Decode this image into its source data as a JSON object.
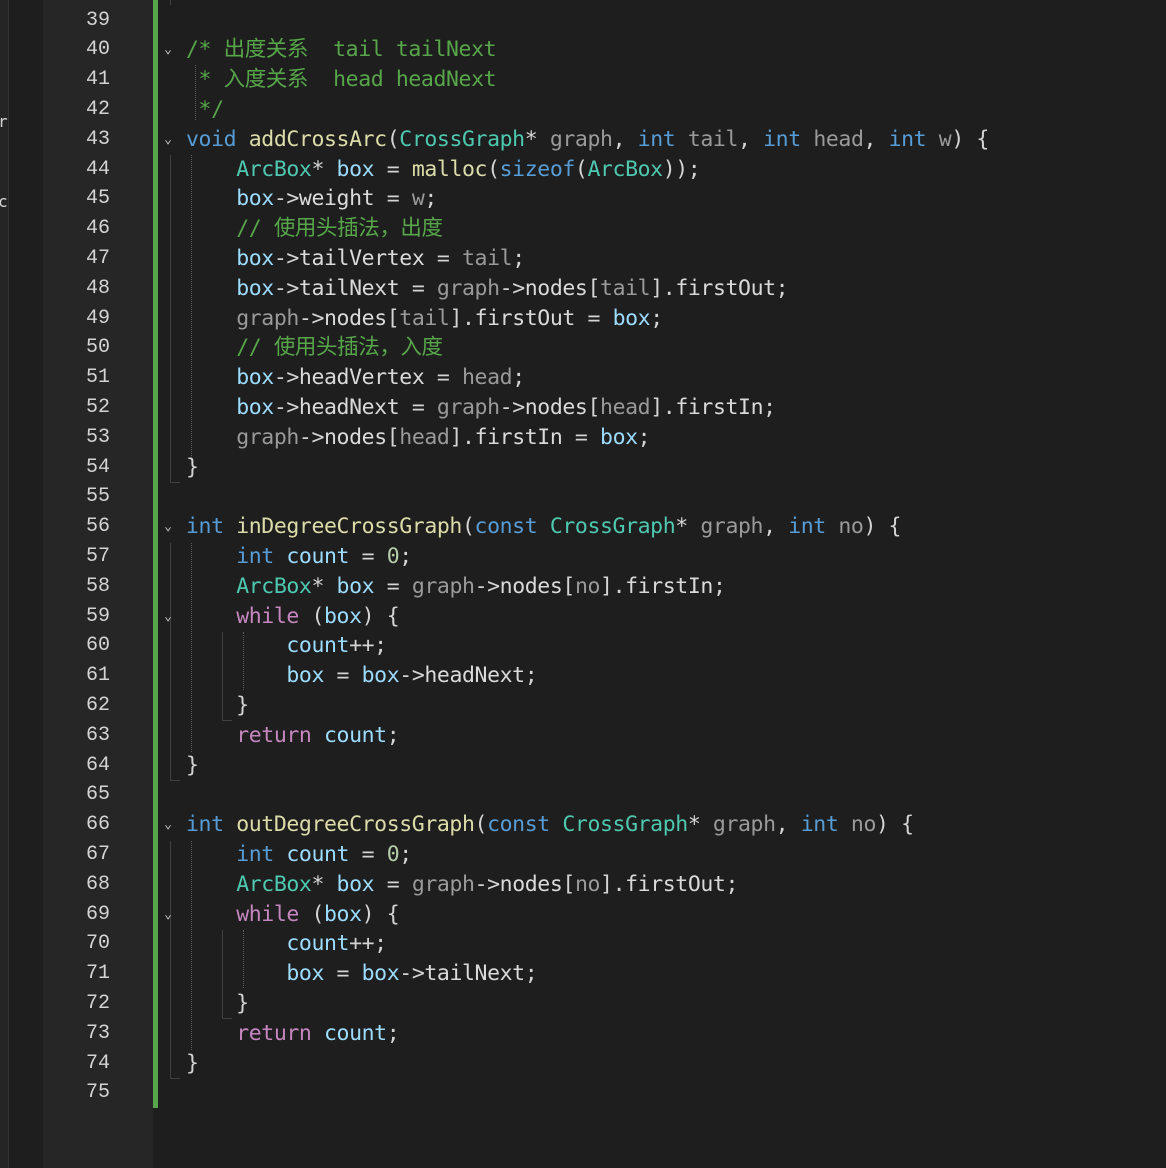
{
  "editor": {
    "language": "C",
    "accent_change_bar": "#58a64b",
    "edge_glyphs": [
      "r",
      "c"
    ],
    "lines": [
      {
        "n": "39",
        "fold": false,
        "tokens": []
      },
      {
        "n": "40",
        "fold": true,
        "tokens": [
          [
            "cm",
            "/* 出度关系  tail tailNext"
          ]
        ]
      },
      {
        "n": "41",
        "fold": false,
        "tokens": [
          [
            "cm",
            " * 入度关系  head headNext"
          ]
        ]
      },
      {
        "n": "42",
        "fold": false,
        "tokens": [
          [
            "cm",
            " */"
          ]
        ]
      },
      {
        "n": "43",
        "fold": true,
        "tokens": [
          [
            "kw",
            "void"
          ],
          [
            "op",
            " "
          ],
          [
            "fn",
            "addCrossArc"
          ],
          [
            "op",
            "("
          ],
          [
            "ty",
            "CrossGraph"
          ],
          [
            "op",
            "* "
          ],
          [
            "prm",
            "graph"
          ],
          [
            "op",
            ", "
          ],
          [
            "kw",
            "int"
          ],
          [
            "op",
            " "
          ],
          [
            "prm",
            "tail"
          ],
          [
            "op",
            ", "
          ],
          [
            "kw",
            "int"
          ],
          [
            "op",
            " "
          ],
          [
            "prm",
            "head"
          ],
          [
            "op",
            ", "
          ],
          [
            "kw",
            "int"
          ],
          [
            "op",
            " "
          ],
          [
            "prm",
            "w"
          ],
          [
            "op",
            ") {"
          ]
        ]
      },
      {
        "n": "44",
        "fold": false,
        "tokens": [
          [
            "op",
            "    "
          ],
          [
            "ty",
            "ArcBox"
          ],
          [
            "op",
            "* "
          ],
          [
            "var",
            "box"
          ],
          [
            "op",
            " = "
          ],
          [
            "fn",
            "malloc"
          ],
          [
            "op",
            "("
          ],
          [
            "kw",
            "sizeof"
          ],
          [
            "op",
            "("
          ],
          [
            "ty",
            "ArcBox"
          ],
          [
            "op",
            "));"
          ]
        ]
      },
      {
        "n": "45",
        "fold": false,
        "tokens": [
          [
            "op",
            "    "
          ],
          [
            "var",
            "box"
          ],
          [
            "op",
            "->"
          ],
          [
            "mem",
            "weight"
          ],
          [
            "op",
            " = "
          ],
          [
            "prm",
            "w"
          ],
          [
            "op",
            ";"
          ]
        ]
      },
      {
        "n": "46",
        "fold": false,
        "tokens": [
          [
            "op",
            "    "
          ],
          [
            "cm",
            "// 使用头插法，出度"
          ]
        ]
      },
      {
        "n": "47",
        "fold": false,
        "tokens": [
          [
            "op",
            "    "
          ],
          [
            "var",
            "box"
          ],
          [
            "op",
            "->"
          ],
          [
            "mem",
            "tailVertex"
          ],
          [
            "op",
            " = "
          ],
          [
            "prm",
            "tail"
          ],
          [
            "op",
            ";"
          ]
        ]
      },
      {
        "n": "48",
        "fold": false,
        "tokens": [
          [
            "op",
            "    "
          ],
          [
            "var",
            "box"
          ],
          [
            "op",
            "->"
          ],
          [
            "mem",
            "tailNext"
          ],
          [
            "op",
            " = "
          ],
          [
            "prm",
            "graph"
          ],
          [
            "op",
            "->"
          ],
          [
            "mem",
            "nodes"
          ],
          [
            "op",
            "["
          ],
          [
            "prm",
            "tail"
          ],
          [
            "op",
            "]."
          ],
          [
            "mem",
            "firstOut"
          ],
          [
            "op",
            ";"
          ]
        ]
      },
      {
        "n": "49",
        "fold": false,
        "tokens": [
          [
            "op",
            "    "
          ],
          [
            "prm",
            "graph"
          ],
          [
            "op",
            "->"
          ],
          [
            "mem",
            "nodes"
          ],
          [
            "op",
            "["
          ],
          [
            "prm",
            "tail"
          ],
          [
            "op",
            "]."
          ],
          [
            "mem",
            "firstOut"
          ],
          [
            "op",
            " = "
          ],
          [
            "var",
            "box"
          ],
          [
            "op",
            ";"
          ]
        ]
      },
      {
        "n": "50",
        "fold": false,
        "tokens": [
          [
            "op",
            "    "
          ],
          [
            "cm",
            "// 使用头插法，入度"
          ]
        ]
      },
      {
        "n": "51",
        "fold": false,
        "tokens": [
          [
            "op",
            "    "
          ],
          [
            "var",
            "box"
          ],
          [
            "op",
            "->"
          ],
          [
            "mem",
            "headVertex"
          ],
          [
            "op",
            " = "
          ],
          [
            "prm",
            "head"
          ],
          [
            "op",
            ";"
          ]
        ]
      },
      {
        "n": "52",
        "fold": false,
        "tokens": [
          [
            "op",
            "    "
          ],
          [
            "var",
            "box"
          ],
          [
            "op",
            "->"
          ],
          [
            "mem",
            "headNext"
          ],
          [
            "op",
            " = "
          ],
          [
            "prm",
            "graph"
          ],
          [
            "op",
            "->"
          ],
          [
            "mem",
            "nodes"
          ],
          [
            "op",
            "["
          ],
          [
            "prm",
            "head"
          ],
          [
            "op",
            "]."
          ],
          [
            "mem",
            "firstIn"
          ],
          [
            "op",
            ";"
          ]
        ]
      },
      {
        "n": "53",
        "fold": false,
        "tokens": [
          [
            "op",
            "    "
          ],
          [
            "prm",
            "graph"
          ],
          [
            "op",
            "->"
          ],
          [
            "mem",
            "nodes"
          ],
          [
            "op",
            "["
          ],
          [
            "prm",
            "head"
          ],
          [
            "op",
            "]."
          ],
          [
            "mem",
            "firstIn"
          ],
          [
            "op",
            " = "
          ],
          [
            "var",
            "box"
          ],
          [
            "op",
            ";"
          ]
        ]
      },
      {
        "n": "54",
        "fold": false,
        "tokens": [
          [
            "op",
            "}"
          ]
        ]
      },
      {
        "n": "55",
        "fold": false,
        "tokens": []
      },
      {
        "n": "56",
        "fold": true,
        "tokens": [
          [
            "kw",
            "int"
          ],
          [
            "op",
            " "
          ],
          [
            "fn",
            "inDegreeCrossGraph"
          ],
          [
            "op",
            "("
          ],
          [
            "kw",
            "const"
          ],
          [
            "op",
            " "
          ],
          [
            "ty",
            "CrossGraph"
          ],
          [
            "op",
            "* "
          ],
          [
            "prm",
            "graph"
          ],
          [
            "op",
            ", "
          ],
          [
            "kw",
            "int"
          ],
          [
            "op",
            " "
          ],
          [
            "prm",
            "no"
          ],
          [
            "op",
            ") {"
          ]
        ]
      },
      {
        "n": "57",
        "fold": false,
        "tokens": [
          [
            "op",
            "    "
          ],
          [
            "kw",
            "int"
          ],
          [
            "op",
            " "
          ],
          [
            "var",
            "count"
          ],
          [
            "op",
            " = "
          ],
          [
            "num",
            "0"
          ],
          [
            "op",
            ";"
          ]
        ]
      },
      {
        "n": "58",
        "fold": false,
        "tokens": [
          [
            "op",
            "    "
          ],
          [
            "ty",
            "ArcBox"
          ],
          [
            "op",
            "* "
          ],
          [
            "var",
            "box"
          ],
          [
            "op",
            " = "
          ],
          [
            "prm",
            "graph"
          ],
          [
            "op",
            "->"
          ],
          [
            "mem",
            "nodes"
          ],
          [
            "op",
            "["
          ],
          [
            "prm",
            "no"
          ],
          [
            "op",
            "]."
          ],
          [
            "mem",
            "firstIn"
          ],
          [
            "op",
            ";"
          ]
        ]
      },
      {
        "n": "59",
        "fold": true,
        "tokens": [
          [
            "op",
            "    "
          ],
          [
            "ctl",
            "while"
          ],
          [
            "op",
            " ("
          ],
          [
            "var",
            "box"
          ],
          [
            "op",
            ") {"
          ]
        ]
      },
      {
        "n": "60",
        "fold": false,
        "tokens": [
          [
            "op",
            "        "
          ],
          [
            "var",
            "count"
          ],
          [
            "op",
            "++;"
          ]
        ]
      },
      {
        "n": "61",
        "fold": false,
        "tokens": [
          [
            "op",
            "        "
          ],
          [
            "var",
            "box"
          ],
          [
            "op",
            " = "
          ],
          [
            "var",
            "box"
          ],
          [
            "op",
            "->"
          ],
          [
            "mem",
            "headNext"
          ],
          [
            "op",
            ";"
          ]
        ]
      },
      {
        "n": "62",
        "fold": false,
        "tokens": [
          [
            "op",
            "    }"
          ]
        ]
      },
      {
        "n": "63",
        "fold": false,
        "tokens": [
          [
            "op",
            "    "
          ],
          [
            "ctl",
            "return"
          ],
          [
            "op",
            " "
          ],
          [
            "var",
            "count"
          ],
          [
            "op",
            ";"
          ]
        ]
      },
      {
        "n": "64",
        "fold": false,
        "tokens": [
          [
            "op",
            "}"
          ]
        ]
      },
      {
        "n": "65",
        "fold": false,
        "tokens": []
      },
      {
        "n": "66",
        "fold": true,
        "tokens": [
          [
            "kw",
            "int"
          ],
          [
            "op",
            " "
          ],
          [
            "fn",
            "outDegreeCrossGraph"
          ],
          [
            "op",
            "("
          ],
          [
            "kw",
            "const"
          ],
          [
            "op",
            " "
          ],
          [
            "ty",
            "CrossGraph"
          ],
          [
            "op",
            "* "
          ],
          [
            "prm",
            "graph"
          ],
          [
            "op",
            ", "
          ],
          [
            "kw",
            "int"
          ],
          [
            "op",
            " "
          ],
          [
            "prm",
            "no"
          ],
          [
            "op",
            ") {"
          ]
        ]
      },
      {
        "n": "67",
        "fold": false,
        "tokens": [
          [
            "op",
            "    "
          ],
          [
            "kw",
            "int"
          ],
          [
            "op",
            " "
          ],
          [
            "var",
            "count"
          ],
          [
            "op",
            " = "
          ],
          [
            "num",
            "0"
          ],
          [
            "op",
            ";"
          ]
        ]
      },
      {
        "n": "68",
        "fold": false,
        "tokens": [
          [
            "op",
            "    "
          ],
          [
            "ty",
            "ArcBox"
          ],
          [
            "op",
            "* "
          ],
          [
            "var",
            "box"
          ],
          [
            "op",
            " = "
          ],
          [
            "prm",
            "graph"
          ],
          [
            "op",
            "->"
          ],
          [
            "mem",
            "nodes"
          ],
          [
            "op",
            "["
          ],
          [
            "prm",
            "no"
          ],
          [
            "op",
            "]."
          ],
          [
            "mem",
            "firstOut"
          ],
          [
            "op",
            ";"
          ]
        ]
      },
      {
        "n": "69",
        "fold": true,
        "tokens": [
          [
            "op",
            "    "
          ],
          [
            "ctl",
            "while"
          ],
          [
            "op",
            " ("
          ],
          [
            "var",
            "box"
          ],
          [
            "op",
            ") {"
          ]
        ]
      },
      {
        "n": "70",
        "fold": false,
        "tokens": [
          [
            "op",
            "        "
          ],
          [
            "var",
            "count"
          ],
          [
            "op",
            "++;"
          ]
        ]
      },
      {
        "n": "71",
        "fold": false,
        "tokens": [
          [
            "op",
            "        "
          ],
          [
            "var",
            "box"
          ],
          [
            "op",
            " = "
          ],
          [
            "var",
            "box"
          ],
          [
            "op",
            "->"
          ],
          [
            "mem",
            "tailNext"
          ],
          [
            "op",
            ";"
          ]
        ]
      },
      {
        "n": "72",
        "fold": false,
        "tokens": [
          [
            "op",
            "    }"
          ]
        ]
      },
      {
        "n": "73",
        "fold": false,
        "tokens": [
          [
            "op",
            "    "
          ],
          [
            "ctl",
            "return"
          ],
          [
            "op",
            " "
          ],
          [
            "var",
            "count"
          ],
          [
            "op",
            ";"
          ]
        ]
      },
      {
        "n": "74",
        "fold": false,
        "tokens": [
          [
            "op",
            "}"
          ]
        ]
      },
      {
        "n": "75",
        "fold": false,
        "tokens": []
      }
    ]
  }
}
